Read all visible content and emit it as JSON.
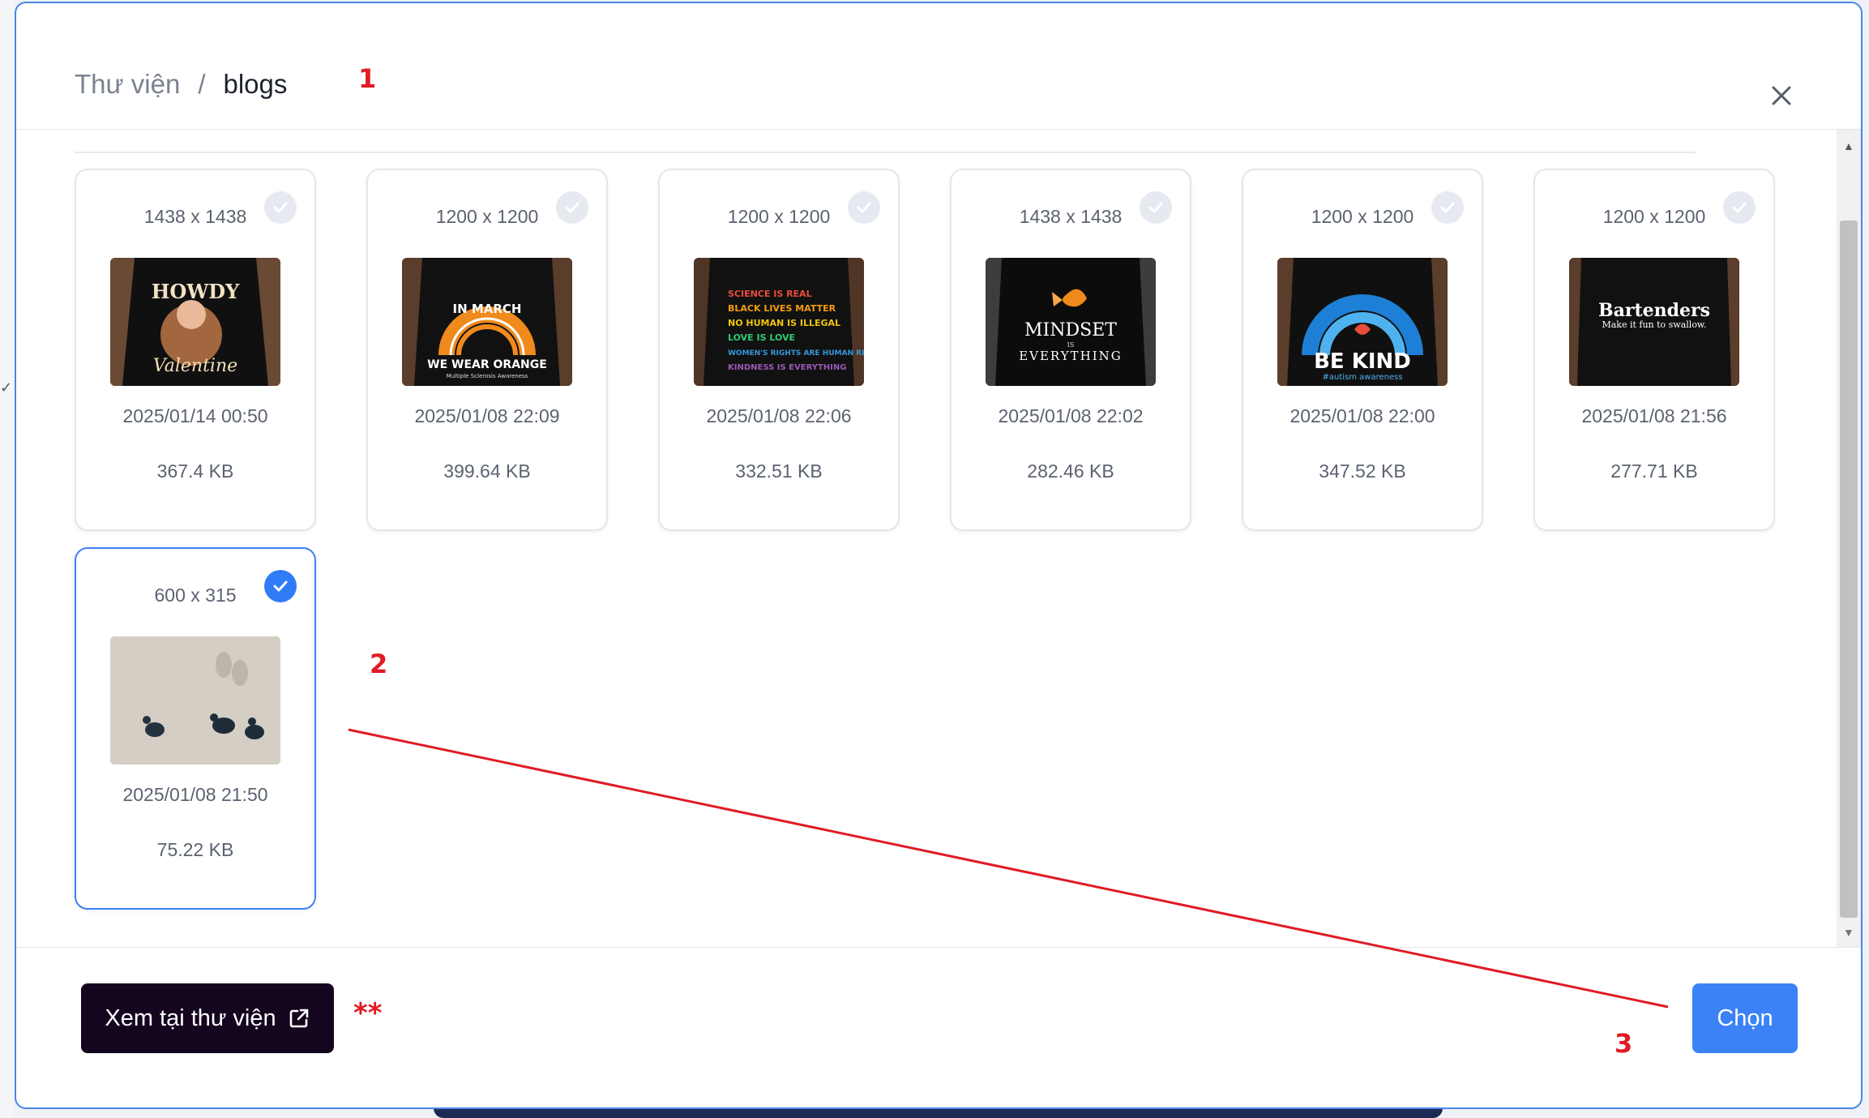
{
  "header": {
    "breadcrumb_root": "Thư viện",
    "breadcrumb_separator": "/",
    "breadcrumb_current": "blogs"
  },
  "cards": [
    {
      "dimensions": "1438 x 1438",
      "date": "2025/01/14 00:50",
      "size": "367.4 KB",
      "selected": false,
      "thumb_text": [
        "HOWDY",
        "Valentine"
      ]
    },
    {
      "dimensions": "1200 x 1200",
      "date": "2025/01/08 22:09",
      "size": "399.64 KB",
      "selected": false,
      "thumb_text": [
        "IN MARCH",
        "WE WEAR ORANGE",
        "Multiple Sclerosis Awareness"
      ]
    },
    {
      "dimensions": "1200 x 1200",
      "date": "2025/01/08 22:06",
      "size": "332.51 KB",
      "selected": false,
      "thumb_text": [
        "SCIENCE IS REAL",
        "BLACK LIVES MATTER",
        "NO HUMAN IS ILLEGAL",
        "LOVE IS LOVE",
        "WOMEN'S RIGHTS ARE HUMAN RIGHTS",
        "KINDNESS IS EVERYTHING"
      ]
    },
    {
      "dimensions": "1438 x 1438",
      "date": "2025/01/08 22:02",
      "size": "282.46 KB",
      "selected": false,
      "thumb_text": [
        "MINDSET",
        "IS",
        "EVERYTHING"
      ]
    },
    {
      "dimensions": "1200 x 1200",
      "date": "2025/01/08 22:00",
      "size": "347.52 KB",
      "selected": false,
      "thumb_text": [
        "BE KIND",
        "#autism awareness"
      ]
    },
    {
      "dimensions": "1200 x 1200",
      "date": "2025/01/08 21:56",
      "size": "277.71 KB",
      "selected": false,
      "thumb_text": [
        "Bartenders",
        "Make it fun to swallow."
      ]
    },
    {
      "dimensions": "600 x 315",
      "date": "2025/01/08 21:50",
      "size": "75.22 KB",
      "selected": true,
      "thumb_text": []
    }
  ],
  "footer": {
    "library_button_label": "Xem tại thư viện",
    "choose_button_label": "Chọn"
  },
  "annotations": {
    "a1": "1",
    "a2": "2",
    "a3": "3",
    "stars": "**"
  },
  "icons": {
    "close": "close-icon",
    "external": "external-link-icon",
    "check": "check-icon"
  },
  "colors": {
    "accent": "#3b82f6",
    "dark_button": "#14061f",
    "annotation": "#e01b24"
  }
}
